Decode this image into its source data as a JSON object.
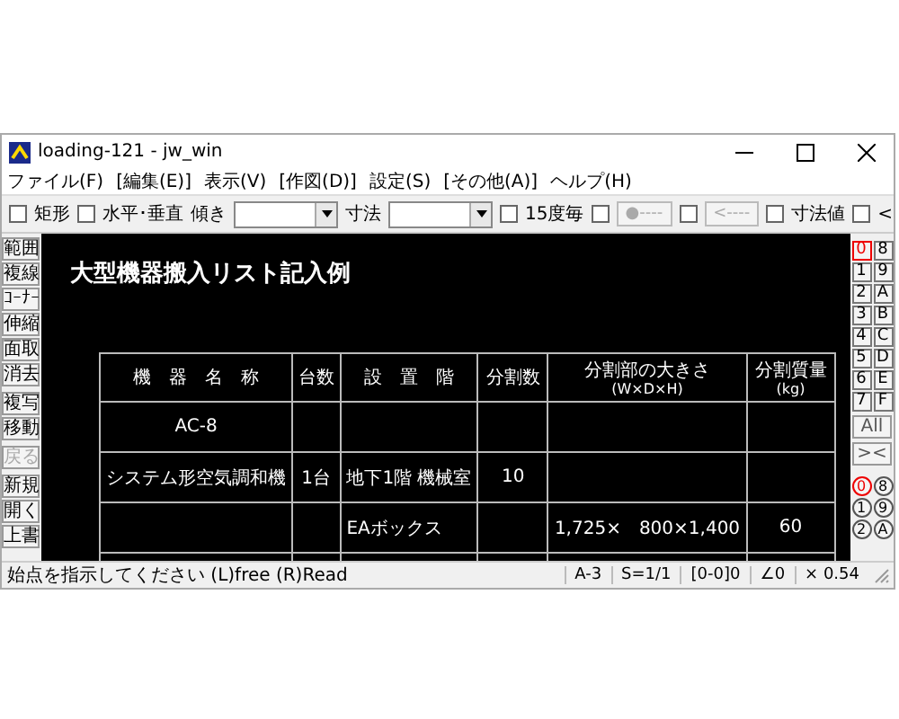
{
  "window": {
    "title": "loading-121 - jw_win"
  },
  "menu": [
    "ファイル(F)",
    "[編集(E)]",
    "表示(V)",
    "[作図(D)]",
    "設定(S)",
    "[その他(A)]",
    "ヘルプ(H)"
  ],
  "toolbar": [
    {
      "kind": "checkbox",
      "label": "矩形",
      "checked": false
    },
    {
      "kind": "checkbox",
      "label": "水平･垂直",
      "checked": false
    },
    {
      "kind": "combo",
      "label": "傾き"
    },
    {
      "kind": "combo",
      "label": "寸法"
    },
    {
      "kind": "checkbox",
      "label": "15度毎",
      "checked": false
    },
    {
      "kind": "checkbutton",
      "button": "●----",
      "checked": false,
      "disabled": true
    },
    {
      "kind": "checkbutton",
      "button": "<----",
      "checked": false,
      "disabled": true
    },
    {
      "kind": "checkbox",
      "label": "寸法値",
      "checked": false
    },
    {
      "kind": "checkbox",
      "label": "<",
      "checked": false
    }
  ],
  "tools": [
    {
      "label": "範囲",
      "disabled": false
    },
    {
      "label": "複線",
      "disabled": false
    },
    {
      "label": "ｺｰﾅｰ",
      "disabled": false
    },
    {
      "label": "伸縮",
      "disabled": false
    },
    {
      "label": "面取",
      "disabled": false
    },
    {
      "label": "消去",
      "disabled": false
    },
    {
      "label": "複写",
      "disabled": false
    },
    {
      "label": "移動",
      "disabled": false
    },
    {
      "label": "戻る",
      "disabled": true
    },
    {
      "label": "新規",
      "disabled": false
    },
    {
      "label": "開く",
      "disabled": false
    },
    {
      "label": "上書",
      "disabled": false
    }
  ],
  "drawing": {
    "title": "大型機器搬入リスト記入例",
    "table": {
      "columns": [
        {
          "label": "機　器　名　称"
        },
        {
          "label": "台数"
        },
        {
          "label": "設　置　階"
        },
        {
          "label": "分割数"
        },
        {
          "label": "分割部の大きさ",
          "unit": "(W×D×H)"
        },
        {
          "label": "分割質量",
          "unit": "(kg)"
        }
      ],
      "rows": [
        [
          "AC-8",
          "",
          "",
          "",
          "",
          ""
        ],
        [
          "システム形空気調和機",
          "1台",
          "地下1階 機械室",
          "10",
          "",
          ""
        ],
        [
          "",
          "",
          "EAボックス",
          "",
          "1,725×　800×1,400",
          "60"
        ],
        [
          "",
          "",
          "",
          "",
          "",
          ""
        ]
      ]
    }
  },
  "layers": [
    {
      "label": "0",
      "selected": true
    },
    {
      "label": "8",
      "selected": false
    },
    {
      "label": "1",
      "selected": false
    },
    {
      "label": "9",
      "selected": false
    },
    {
      "label": "2",
      "selected": false
    },
    {
      "label": "A",
      "selected": false
    },
    {
      "label": "3",
      "selected": false
    },
    {
      "label": "B",
      "selected": false
    },
    {
      "label": "4",
      "selected": false
    },
    {
      "label": "C",
      "selected": false
    },
    {
      "label": "5",
      "selected": false
    },
    {
      "label": "D",
      "selected": false
    },
    {
      "label": "6",
      "selected": false
    },
    {
      "label": "E",
      "selected": false
    },
    {
      "label": "7",
      "selected": false
    },
    {
      "label": "F",
      "selected": false
    }
  ],
  "layer_buttons": [
    "All",
    "><"
  ],
  "layer_groups": [
    {
      "label": "0",
      "selected": true
    },
    {
      "label": "8",
      "selected": false
    },
    {
      "label": "1",
      "selected": false
    },
    {
      "label": "9",
      "selected": false
    },
    {
      "label": "2",
      "selected": false
    },
    {
      "label": "A",
      "selected": false
    }
  ],
  "status_bar": {
    "message": "始点を指示してください (L)free (R)Read",
    "panes": [
      "A-3",
      "S=1/1",
      "[0-0]0",
      "∠0",
      "× 0.54"
    ]
  }
}
